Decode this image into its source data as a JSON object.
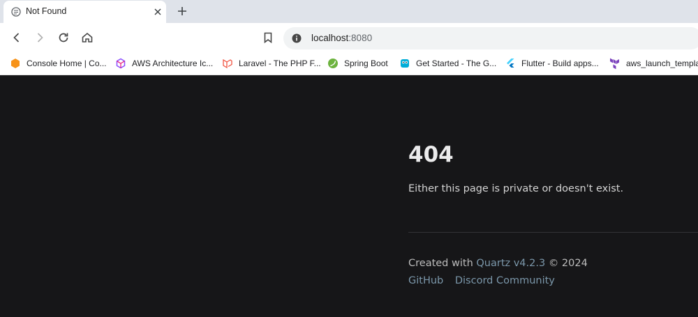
{
  "tab": {
    "title": "Not Found",
    "favicon": "page-icon"
  },
  "address_bar": {
    "host": "localhost",
    "port": ":8080"
  },
  "bookmarks": [
    {
      "label": "Console Home | Co...",
      "icon": "aws-console-icon",
      "color": "#f7931a"
    },
    {
      "label": "AWS Architecture Ic...",
      "icon": "aws-architecture-icon",
      "color": "#8c4fff"
    },
    {
      "label": "Laravel - The PHP F...",
      "icon": "laravel-icon",
      "color": "#f05340"
    },
    {
      "label": "Spring Boot",
      "icon": "spring-icon",
      "color": "#6db33f"
    },
    {
      "label": "Get Started - The G...",
      "icon": "gopher-icon",
      "color": "#00add8"
    },
    {
      "label": "Flutter - Build apps...",
      "icon": "flutter-icon",
      "color": "#44d1fd"
    },
    {
      "label": "aws_launch_templa...",
      "icon": "terraform-icon",
      "color": "#7b42bc"
    }
  ],
  "page": {
    "code": "404",
    "message": "Either this page is private or doesn't exist.",
    "footer": {
      "created_prefix": "Created with",
      "quartz": "Quartz v4.2.3",
      "copyright": "© 2024",
      "links": [
        "GitHub",
        "Discord Community"
      ]
    }
  },
  "colors": {
    "page_bg": "#161618",
    "link": "#7b97aa",
    "heading": "#ebebec"
  }
}
